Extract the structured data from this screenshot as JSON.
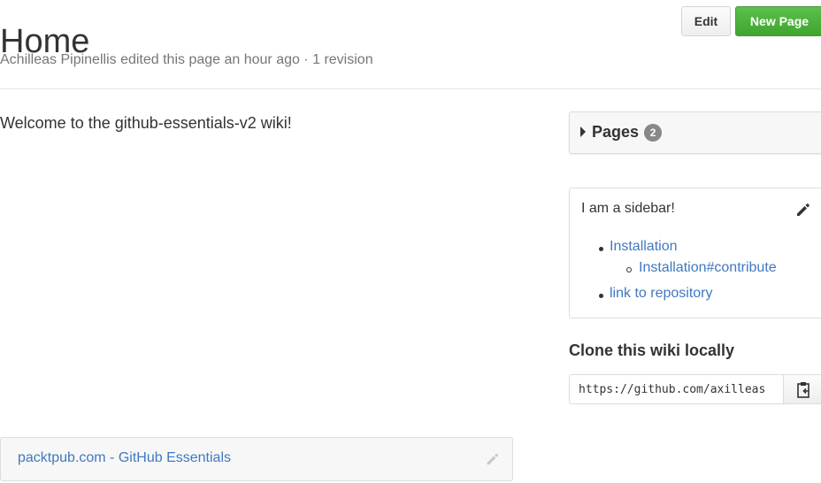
{
  "page": {
    "title": "Home",
    "meta": "Achilleas Pipinellis edited this page an hour ago · 1 revision"
  },
  "actions": {
    "edit_label": "Edit",
    "new_page_label": "New Page"
  },
  "content": {
    "text": "Welcome to the github-essentials-v2 wiki!"
  },
  "pages_panel": {
    "label": "Pages",
    "count": "2"
  },
  "sidebar": {
    "text": "I am a sidebar!",
    "links": {
      "installation": "Installation",
      "installation_contribute": "Installation#contribute",
      "repository": "link to repository"
    }
  },
  "clone": {
    "title": "Clone this wiki locally",
    "url": "https://github.com/axilleas"
  },
  "footer": {
    "link_text": "packtpub.com - GitHub Essentials"
  },
  "icons": {
    "caret": "caret-right-icon",
    "sidebar_edit": "pencil-icon",
    "clipboard": "clipboard-icon",
    "footer_edit": "pencil-icon"
  },
  "colors": {
    "link": "#4078c0",
    "new_page": "#3fa52f",
    "counter": "#888888"
  }
}
